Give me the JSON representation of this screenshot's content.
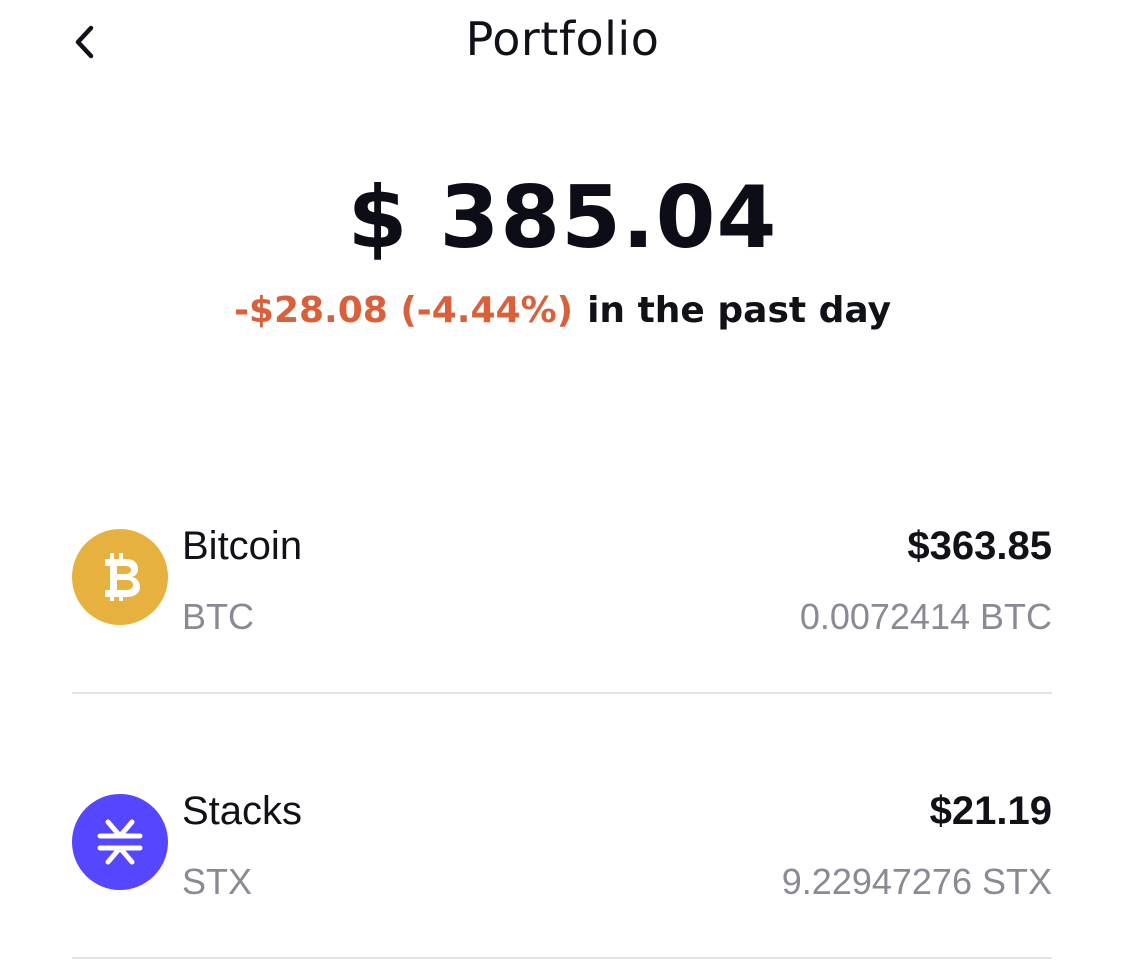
{
  "header": {
    "back_icon": "chevron-left-icon",
    "title": "Portfolio"
  },
  "summary": {
    "balance": "$ 385.04",
    "change_amount": "-$28.08 (-4.44%)",
    "change_suffix": "in the past day",
    "change_color": "#d9603a"
  },
  "assets": [
    {
      "name": "Bitcoin",
      "symbol": "BTC",
      "value": "$363.85",
      "amount": "0.0072414 BTC",
      "icon": "bitcoin-icon",
      "icon_color": "#e6b13e"
    },
    {
      "name": "Stacks",
      "symbol": "STX",
      "value": "$21.19",
      "amount": "9.22947276 STX",
      "icon": "stacks-icon",
      "icon_color": "#5546ff"
    }
  ]
}
